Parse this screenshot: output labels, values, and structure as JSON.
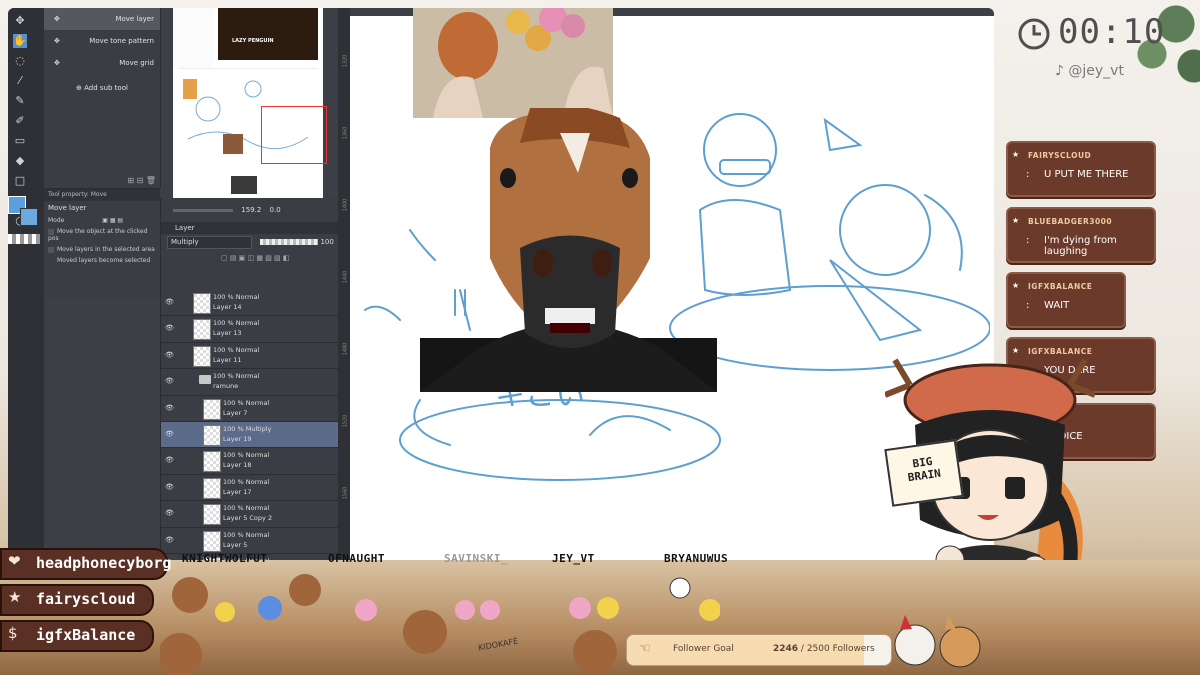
{
  "stream": {
    "timer": "00:10",
    "tiktok_handle": "@jey_vt",
    "tiktok_icon": "tiktok-icon",
    "clock_icon": "clock-icon",
    "sticker_text": [
      "BIG",
      "BRAIN"
    ]
  },
  "chat": [
    {
      "user": "FAIRYSCLOUD",
      "message": "U PUT ME THERE"
    },
    {
      "user": "BLUEBADGER3000",
      "message": "I'm dying from laughing"
    },
    {
      "user": "IGFXBALANCE",
      "message": "WAIT"
    },
    {
      "user": "IGFXBALANCE",
      "message": "YOU DARE"
    },
    {
      "user": "",
      "message": "CHOICE"
    }
  ],
  "events": [
    {
      "icon": "heart-icon",
      "name": "headphonecyborg"
    },
    {
      "icon": "star-icon",
      "name": "fairyscloud"
    },
    {
      "icon": "dollar-icon",
      "name": "igfxBalance"
    }
  ],
  "viewers": [
    {
      "name": "KNIGHTWOLFUT",
      "dim": false
    },
    {
      "name": "OFNAUGHT",
      "dim": false
    },
    {
      "name": "SAVINSKI_",
      "dim": true
    },
    {
      "name": "JEY_VT",
      "dim": false
    },
    {
      "name": "BRYANUWUS",
      "dim": false
    }
  ],
  "follower_goal": {
    "label": "Follower Goal",
    "current": "2246",
    "rest": " / 2500 Followers",
    "progress": 0.8984
  },
  "desk_sign": "KIDOKAFÉ",
  "csp": {
    "subtools": [
      {
        "label": "Move layer",
        "active": true
      },
      {
        "label": "Move tone pattern",
        "active": false
      },
      {
        "label": "Move grid",
        "active": false
      }
    ],
    "add_subtool": "Add sub tool",
    "tool_property_header": "Tool property: Move",
    "tool_property_name": "Move layer",
    "mode_label": "Mode",
    "options": [
      "Move the object at the clicked pos",
      "Move layers in the selected area",
      "Moved layers become selected"
    ],
    "zoom_value": "159.2",
    "rotation_value": "0.0",
    "layer_tab": "Layer",
    "blend_mode": "Multiply",
    "opacity": "100",
    "poster_title": "LAZY PENGUIN",
    "layers": [
      {
        "mode": "100 % Normal",
        "name": "Layer 14",
        "indent": false,
        "folder": false,
        "selected": false
      },
      {
        "mode": "100 % Normal",
        "name": "Layer 13",
        "indent": false,
        "folder": false,
        "selected": false
      },
      {
        "mode": "100 % Normal",
        "name": "Layer 11",
        "indent": false,
        "folder": false,
        "selected": false
      },
      {
        "mode": "100 % Normal",
        "name": "ramune",
        "indent": false,
        "folder": true,
        "selected": false
      },
      {
        "mode": "100 % Normal",
        "name": "Layer 7",
        "indent": true,
        "folder": false,
        "selected": false
      },
      {
        "mode": "100 % Multiply",
        "name": "Layer 19",
        "indent": true,
        "folder": false,
        "selected": true
      },
      {
        "mode": "100 % Normal",
        "name": "Layer 18",
        "indent": true,
        "folder": false,
        "selected": false
      },
      {
        "mode": "100 % Normal",
        "name": "Layer 17",
        "indent": true,
        "folder": false,
        "selected": false
      },
      {
        "mode": "100 % Normal",
        "name": "Layer 5 Copy 2",
        "indent": true,
        "folder": false,
        "selected": false
      },
      {
        "mode": "100 % Normal",
        "name": "Layer 5",
        "indent": true,
        "folder": false,
        "selected": false
      },
      {
        "mode": "100 % Normal",
        "name": "",
        "indent": true,
        "folder": false,
        "selected": false
      }
    ],
    "ruler_ticks": [
      "1320",
      "1360",
      "1400",
      "1440",
      "1480",
      "1520",
      "1560"
    ],
    "sketch_text": "キこい"
  }
}
